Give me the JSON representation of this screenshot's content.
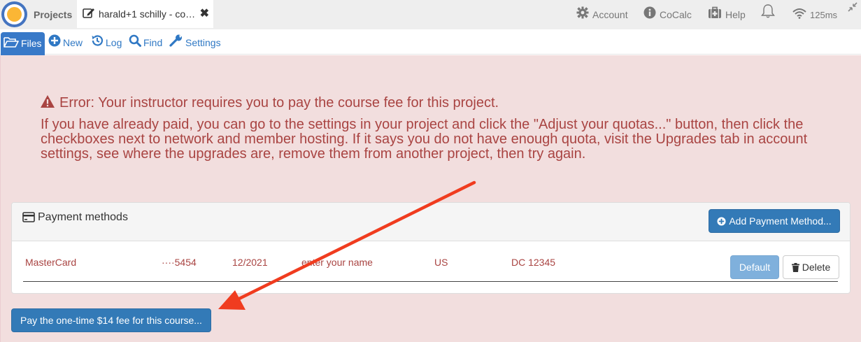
{
  "topbar": {
    "projects_label": "Projects",
    "file_tab_label": "harald+1 schilly - co…",
    "account_label": "Account",
    "cocalc_label": "CoCalc",
    "help_label": "Help",
    "ping_label": "125ms"
  },
  "actionbar": {
    "files_label": "Files",
    "new_label": "New",
    "log_label": "Log",
    "find_label": "Find",
    "settings_label": "Settings"
  },
  "error": {
    "title": "Error: Your instructor requires you to pay the course fee for this project.",
    "body": "If you have already paid, you can go to the settings in your project and click the \"Adjust your quotas...\" button, then click the checkboxes next to network and member hosting. If it says you do not have enough quota, visit the Upgrades tab in account settings, see where the upgrades are, remove them from another project, then try again."
  },
  "payment": {
    "title": "Payment methods",
    "add_button": "Add Payment Method...",
    "card": {
      "brand": "MasterCard",
      "last4": "····5454",
      "expiry": "12/2021",
      "name": "enter your name",
      "country": "US",
      "region_zip": "DC  12345"
    },
    "default_button": "Default",
    "delete_button": "Delete"
  },
  "pay_button": "Pay the one-time $14 fee for this course...",
  "colors": {
    "primary": "#337ab7",
    "error_text": "#a94442",
    "error_bg": "#f2dede",
    "annotation_arrow": "#f03c1f"
  }
}
